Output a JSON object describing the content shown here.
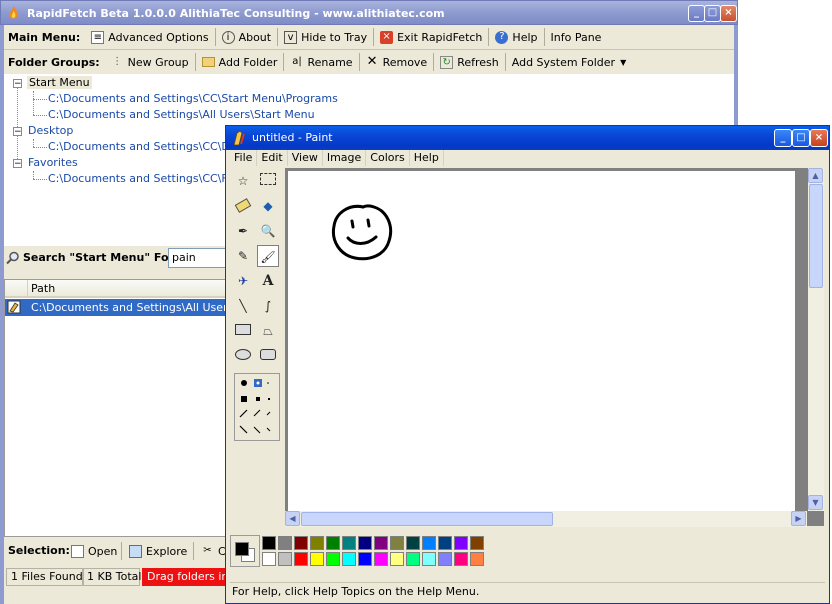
{
  "rapidfetch": {
    "title": "RapidFetch Beta 1.0.0.0 AlithiaTec Consulting - www.alithiatec.com",
    "main_menu": {
      "label": "Main Menu:",
      "items": [
        "Advanced Options",
        "About",
        "Hide to Tray",
        "Exit RapidFetch",
        "Help",
        "Info Pane"
      ]
    },
    "folder_groups": {
      "label": "Folder Groups:",
      "items": [
        "New Group",
        "Add Folder",
        "Rename",
        "Remove",
        "Refresh",
        "Add System Folder"
      ]
    },
    "tree": {
      "groups": [
        {
          "name": "Start Menu",
          "children": [
            "C:\\Documents and Settings\\CC\\Start Menu\\Programs",
            "C:\\Documents and Settings\\All Users\\Start Menu"
          ]
        },
        {
          "name": "Desktop",
          "children": [
            "C:\\Documents and Settings\\CC\\Deskt"
          ]
        },
        {
          "name": "Favorites",
          "children": [
            "C:\\Documents and Settings\\CC\\Favori"
          ]
        }
      ]
    },
    "search": {
      "label": "Search \"Start Menu\" For:",
      "value": "pain"
    },
    "results": {
      "column": "Path",
      "rows": [
        "C:\\Documents and Settings\\All Users\\Sta"
      ]
    },
    "selection": {
      "label": "Selection:",
      "items": [
        "Open",
        "Explore",
        "Cu"
      ]
    },
    "status": {
      "files": "1 Files Found",
      "size": "1 KB Total",
      "hint": "Drag folders into"
    }
  },
  "paint": {
    "title": "untitled - Paint",
    "menu": [
      "File",
      "Edit",
      "View",
      "Image",
      "Colors",
      "Help"
    ],
    "status": "For Help, click Help Topics on the Help Menu.",
    "tools": [
      "free-form-select",
      "select",
      "eraser",
      "fill",
      "pick-color",
      "magnifier",
      "pencil",
      "brush",
      "airbrush",
      "text",
      "line",
      "curve",
      "rectangle",
      "polygon",
      "ellipse",
      "rounded-rectangle"
    ],
    "active_tool": "brush",
    "foreground_color": "#000000",
    "background_color": "#ffffff",
    "palette_top": [
      "#000000",
      "#808080",
      "#800000",
      "#808000",
      "#008000",
      "#008080",
      "#000080",
      "#800080",
      "#808040",
      "#004040",
      "#0080ff",
      "#004080",
      "#8000ff",
      "#804000"
    ],
    "palette_bottom": [
      "#ffffff",
      "#c0c0c0",
      "#ff0000",
      "#ffff00",
      "#00ff00",
      "#00ffff",
      "#0000ff",
      "#ff00ff",
      "#ffff80",
      "#00ff80",
      "#80ffff",
      "#8080ff",
      "#ff0080",
      "#ff8040"
    ]
  }
}
